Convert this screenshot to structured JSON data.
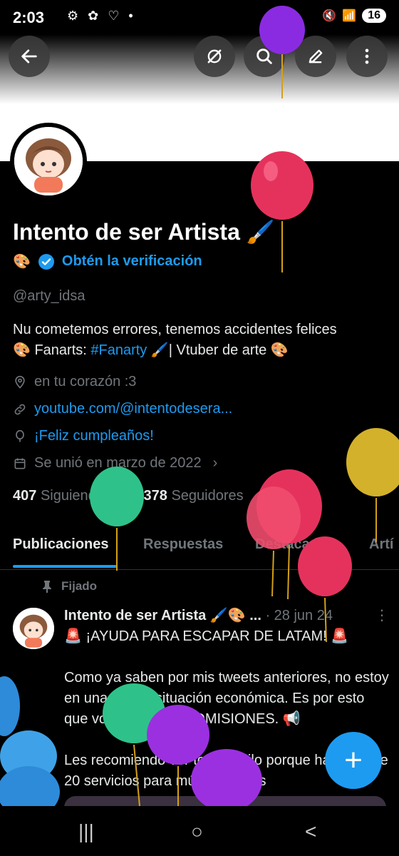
{
  "status_bar": {
    "time": "2:03",
    "notif_icons": "⚙ ✿ ♡ •",
    "signal": "5",
    "battery": "16"
  },
  "top_actions": {
    "back": "back-arrow-icon",
    "grok": "grok-icon",
    "search": "search-icon",
    "edit": "edit-icon",
    "more": "more-vertical-icon"
  },
  "profile": {
    "name": "Intento de ser Artista 🖌️",
    "verify_emoji": "🎨",
    "verify_link": "Obtén la verificación",
    "handle": "@arty_idsa",
    "bio_line1": "Nu cometemos errores, tenemos accidentes felices",
    "bio_line2_pre": "🎨  Fanarts: ",
    "bio_hashtag": "#Fanarty",
    "bio_line2_post": " 🖌️| Vtuber de arte 🎨",
    "location": "en tu corazón :3",
    "website": "youtube.com/@intentodesera...",
    "birthday": "¡Feliz cumpleaños!",
    "joined": "Se unió en marzo de 2022",
    "following_count": "407",
    "following_label": "Siguiendo",
    "followers_count": "14.378",
    "followers_label": "Seguidores"
  },
  "tabs": [
    "Publicaciones",
    "Respuestas",
    "Destacados",
    "Artí"
  ],
  "pinned_post": {
    "pinned_label": "Fijado",
    "author": "Intento de ser Artista 🖌️🎨 ...",
    "date": "· 28 jun 24",
    "line1": "🚨 ¡AYUDA PARA ESCAPAR DE LATAM! 🚨",
    "para1": "Como ya saben por mis tweets anteriores, no estoy en una buena situación económica. Es por esto que volví a ABRIR COMISIONES. 📢",
    "para2": "Les recomiendo ver todo el hilo porque hay mas de 20 servicios para múltiples usos"
  },
  "fab": "+",
  "nav": {
    "recent": "|||",
    "home": "○",
    "back": "<"
  },
  "colors": {
    "accent": "#1d9bf0",
    "background": "#000000",
    "muted": "#71767b"
  }
}
